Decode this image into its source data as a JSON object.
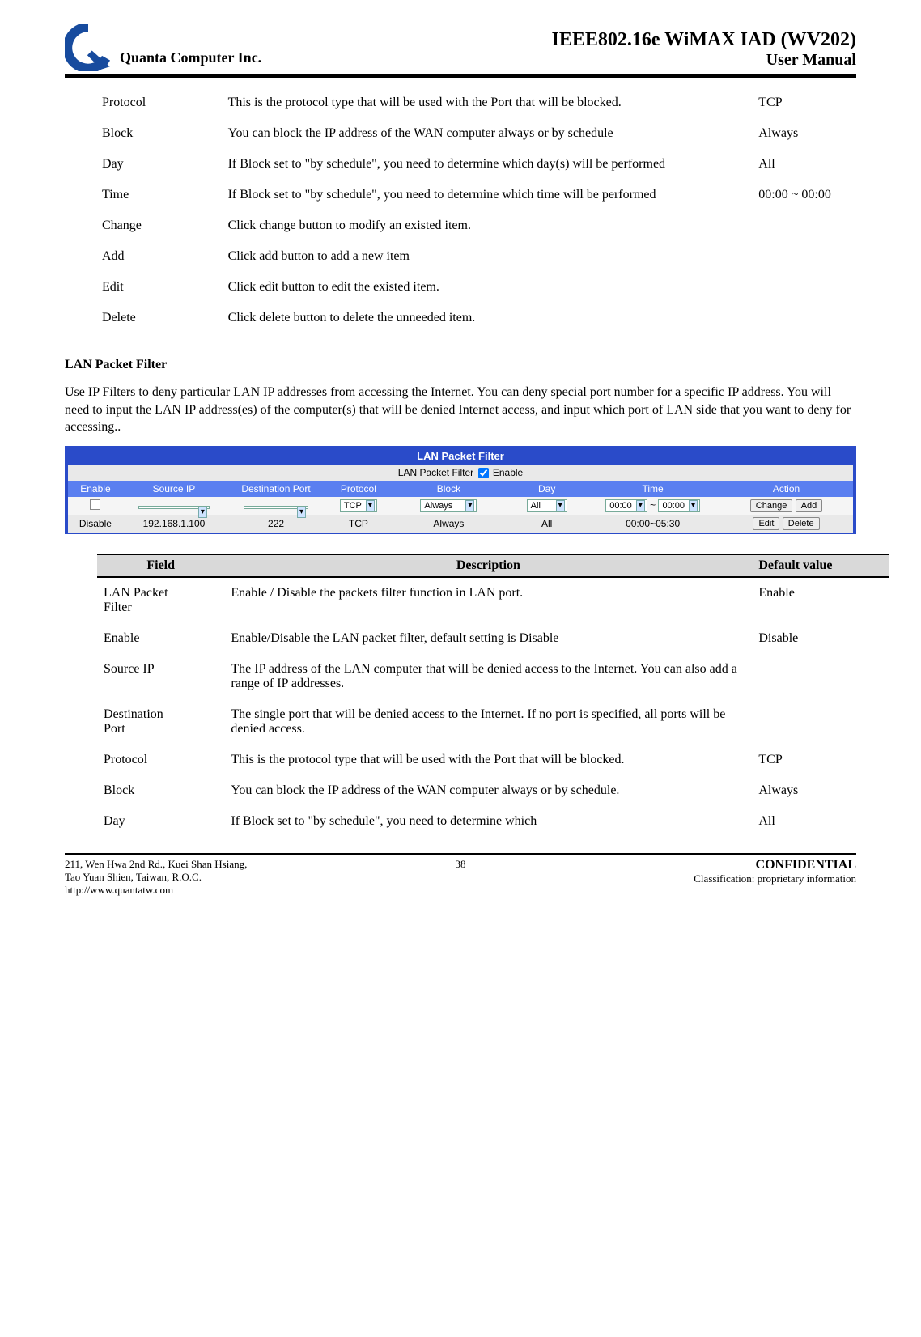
{
  "header": {
    "company": "Quanta  Computer  Inc.",
    "title_line1": "IEEE802.16e  WiMAX  IAD  (WV202)",
    "title_line2": "User  Manual"
  },
  "upper_rows": [
    {
      "field": "Protocol",
      "desc": "This is the protocol type that will be used with the Port that will be blocked.",
      "def": "TCP"
    },
    {
      "field": "Block",
      "desc": "You can block the IP address of the WAN computer always or by schedule",
      "def": "Always"
    },
    {
      "field": "Day",
      "desc": "If Block set to \"by schedule\", you need to determine which day(s) will be performed",
      "def": "All"
    },
    {
      "field": "Time",
      "desc": "If Block set to \"by schedule\", you need to determine which time will be performed",
      "def": "00:00 ~ 00:00"
    },
    {
      "field": "Change",
      "desc": "Click change button to modify an existed item.",
      "def": ""
    },
    {
      "field": "Add",
      "desc": "Click add button to add a new item",
      "def": ""
    },
    {
      "field": "Edit",
      "desc": "Click edit button to edit the existed item.",
      "def": ""
    },
    {
      "field": "Delete",
      "desc": "Click delete button to delete the unneeded item.",
      "def": ""
    }
  ],
  "section_heading": "LAN Packet Filter",
  "section_para": "Use IP Filters to deny particular LAN IP addresses from accessing the Internet. You can deny special port number for a specific IP address. You will need to input the LAN IP address(es) of the computer(s) that will be denied Internet access, and input which port of LAN side that you want to deny for accessing..",
  "ui": {
    "title": "LAN Packet Filter",
    "sub_label": "LAN Packet Filter",
    "sub_enable": "Enable",
    "cols": [
      "Enable",
      "Source IP",
      "Destination Port",
      "Protocol",
      "Block",
      "Day",
      "Time",
      "Action"
    ],
    "row_edit": {
      "protocol": "TCP",
      "block": "Always",
      "day": "All",
      "time1": "00:00",
      "time2": "00:00",
      "btn_change": "Change",
      "btn_add": "Add"
    },
    "row_static": {
      "enable": "Disable",
      "source": "192.168.1.100",
      "dest": "222",
      "protocol": "TCP",
      "block": "Always",
      "day": "All",
      "time": "00:00~05:30",
      "btn_edit": "Edit",
      "btn_delete": "Delete"
    }
  },
  "desc_table_headers": {
    "field": "Field",
    "desc": "Description",
    "def": "Default value"
  },
  "lower_rows": [
    {
      "field_a": "LAN Packet",
      "field_b": "Filter",
      "desc": "Enable / Disable the packets filter function in LAN port.",
      "def": "Enable"
    },
    {
      "field": "Enable",
      "desc": "Enable/Disable the LAN packet filter, default setting is Disable",
      "def": "Disable"
    },
    {
      "field": "Source IP",
      "desc": "The IP address of the LAN computer that will be denied access to the Internet. You can also add a range of IP addresses.",
      "def": ""
    },
    {
      "field_a": "Destination",
      "field_b": "Port",
      "desc": "The single port that will be denied access to the Internet. If no port is specified, all ports will be denied access.",
      "def": ""
    },
    {
      "field": "Protocol",
      "desc": "This is the protocol type that will be used with the Port that will be blocked.",
      "def": "TCP"
    },
    {
      "field": "Block",
      "desc": "You can block the IP address of the WAN computer always or by schedule.",
      "def": "Always"
    },
    {
      "field": "Day",
      "desc": "If Block set to \"by schedule\", you need to determine which",
      "def": "All"
    }
  ],
  "footer": {
    "addr1": "211, Wen Hwa 2nd Rd., Kuei Shan Hsiang,",
    "addr2": "Tao Yuan Shien, Taiwan, R.O.C.",
    "addr3": "http://www.quantatw.com",
    "pageno": "38",
    "conf": "CONFIDENTIAL",
    "class": "Classification: proprietary information"
  }
}
